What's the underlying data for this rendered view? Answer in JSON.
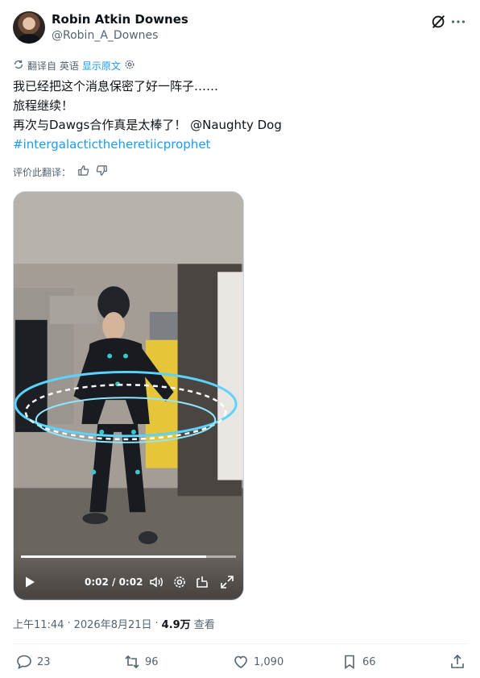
{
  "author": {
    "name": "Robin Atkin Downes",
    "handle": "@Robin_A_Downes"
  },
  "translation": {
    "note": "翻译自 英语",
    "show_original": "显示原文"
  },
  "tweet": {
    "lines": [
      "我已经把这个消息保密了好一阵子……",
      "旅程继续！",
      "再次与Dawgs合作真是太棒了！ @Naughty Dog",
      "#intergalactictheheretiicprophet"
    ]
  },
  "rate": {
    "label": "评价此翻译："
  },
  "video": {
    "time": "0:02 / 0:02",
    "progress": 0.86
  },
  "meta": {
    "time": "上午11:44",
    "sep": "·",
    "date": "2026年8月21日",
    "views": "4.9万",
    "views_label": "查看"
  },
  "actions": {
    "replies": "23",
    "reposts": "96",
    "likes": "1,090",
    "bookmarks": "66"
  },
  "colors": {
    "accent": "#1d9bf0",
    "text": "#0f1419",
    "muted": "#536471"
  }
}
